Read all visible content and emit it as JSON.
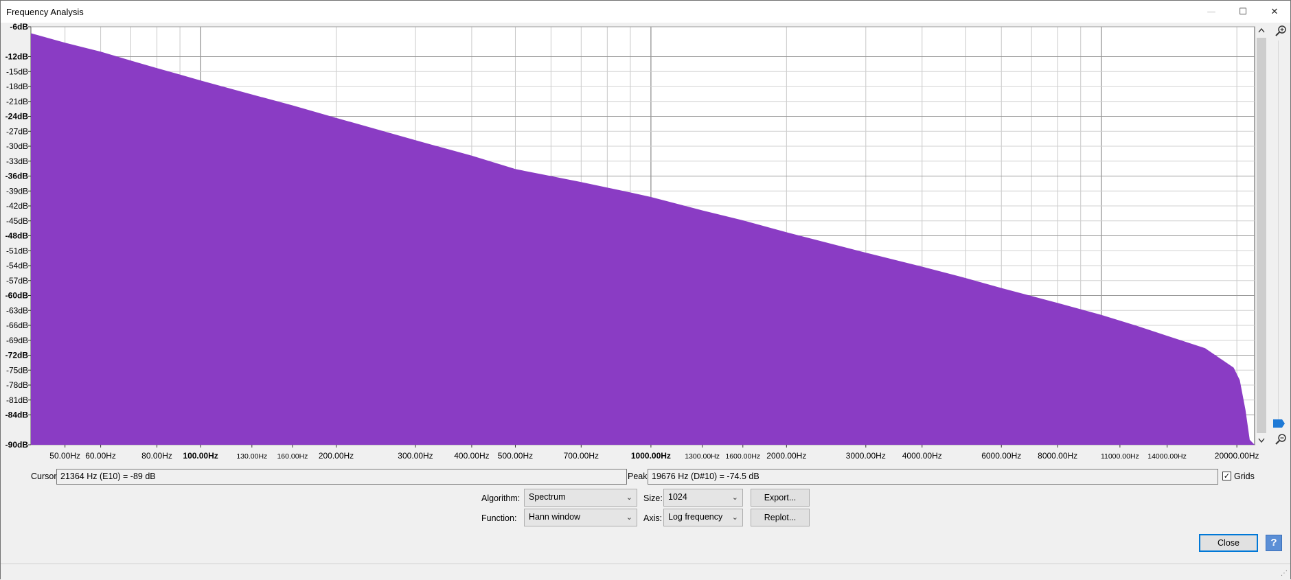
{
  "window": {
    "title": "Frequency Analysis",
    "controls": {
      "minimize": "—",
      "maximize": "☐",
      "close": "✕"
    }
  },
  "chart_data": {
    "type": "area",
    "x_scale": "log",
    "xlabel": "",
    "ylabel": "",
    "xlim": [
      42,
      21900
    ],
    "ylim": [
      -90,
      -6
    ],
    "grid": true,
    "fill_color": "#8a3cc4",
    "x_ticks": [
      {
        "value": 50,
        "label": "50.00Hz",
        "small": false,
        "bold": false
      },
      {
        "value": 60,
        "label": "60.00Hz",
        "small": false,
        "bold": false
      },
      {
        "value": 80,
        "label": "80.00Hz",
        "small": false,
        "bold": false
      },
      {
        "value": 100,
        "label": "100.00Hz",
        "small": false,
        "bold": true
      },
      {
        "value": 130,
        "label": "130.00Hz",
        "small": true,
        "bold": false
      },
      {
        "value": 160,
        "label": "160.00Hz",
        "small": true,
        "bold": false
      },
      {
        "value": 200,
        "label": "200.00Hz",
        "small": false,
        "bold": false
      },
      {
        "value": 300,
        "label": "300.00Hz",
        "small": false,
        "bold": false
      },
      {
        "value": 400,
        "label": "400.00Hz",
        "small": false,
        "bold": false
      },
      {
        "value": 500,
        "label": "500.00Hz",
        "small": false,
        "bold": false
      },
      {
        "value": 700,
        "label": "700.00Hz",
        "small": false,
        "bold": false
      },
      {
        "value": 1000,
        "label": "1000.00Hz",
        "small": false,
        "bold": true
      },
      {
        "value": 1300,
        "label": "1300.00Hz",
        "small": true,
        "bold": false
      },
      {
        "value": 1600,
        "label": "1600.00Hz",
        "small": true,
        "bold": false
      },
      {
        "value": 2000,
        "label": "2000.00Hz",
        "small": false,
        "bold": false
      },
      {
        "value": 3000,
        "label": "3000.00Hz",
        "small": false,
        "bold": false
      },
      {
        "value": 4000,
        "label": "4000.00Hz",
        "small": false,
        "bold": false
      },
      {
        "value": 6000,
        "label": "6000.00Hz",
        "small": false,
        "bold": false
      },
      {
        "value": 8000,
        "label": "8000.00Hz",
        "small": false,
        "bold": false
      },
      {
        "value": 11000,
        "label": "11000.00Hz",
        "small": true,
        "bold": false
      },
      {
        "value": 14000,
        "label": "14000.00Hz",
        "small": true,
        "bold": false
      },
      {
        "value": 20000,
        "label": "20000.00Hz",
        "small": false,
        "bold": false
      }
    ],
    "x_gridlines": [
      50,
      60,
      70,
      80,
      90,
      100,
      200,
      300,
      400,
      500,
      600,
      700,
      800,
      900,
      1000,
      2000,
      3000,
      4000,
      5000,
      6000,
      7000,
      8000,
      9000,
      10000,
      20000
    ],
    "y_ticks": [
      {
        "value": -6,
        "label": "-6dB",
        "bold": true
      },
      {
        "value": -12,
        "label": "-12dB",
        "bold": true
      },
      {
        "value": -15,
        "label": "-15dB",
        "bold": false
      },
      {
        "value": -18,
        "label": "-18dB",
        "bold": false
      },
      {
        "value": -21,
        "label": "-21dB",
        "bold": false
      },
      {
        "value": -24,
        "label": "-24dB",
        "bold": true
      },
      {
        "value": -27,
        "label": "-27dB",
        "bold": false
      },
      {
        "value": -30,
        "label": "-30dB",
        "bold": false
      },
      {
        "value": -33,
        "label": "-33dB",
        "bold": false
      },
      {
        "value": -36,
        "label": "-36dB",
        "bold": true
      },
      {
        "value": -39,
        "label": "-39dB",
        "bold": false
      },
      {
        "value": -42,
        "label": "-42dB",
        "bold": false
      },
      {
        "value": -45,
        "label": "-45dB",
        "bold": false
      },
      {
        "value": -48,
        "label": "-48dB",
        "bold": true
      },
      {
        "value": -51,
        "label": "-51dB",
        "bold": false
      },
      {
        "value": -54,
        "label": "-54dB",
        "bold": false
      },
      {
        "value": -57,
        "label": "-57dB",
        "bold": false
      },
      {
        "value": -60,
        "label": "-60dB",
        "bold": true
      },
      {
        "value": -63,
        "label": "-63dB",
        "bold": false
      },
      {
        "value": -66,
        "label": "-66dB",
        "bold": false
      },
      {
        "value": -69,
        "label": "-69dB",
        "bold": false
      },
      {
        "value": -72,
        "label": "-72dB",
        "bold": true
      },
      {
        "value": -75,
        "label": "-75dB",
        "bold": false
      },
      {
        "value": -78,
        "label": "-78dB",
        "bold": false
      },
      {
        "value": -81,
        "label": "-81dB",
        "bold": false
      },
      {
        "value": -84,
        "label": "-84dB",
        "bold": true
      },
      {
        "value": -90,
        "label": "-90dB",
        "bold": true
      }
    ],
    "series": [
      {
        "x": [
          42,
          50,
          60,
          70,
          80,
          90,
          100,
          130,
          160,
          200,
          300,
          400,
          500,
          700,
          900,
          1000,
          1300,
          1600,
          2000,
          3000,
          4000,
          5000,
          6000,
          7000,
          8000,
          10000,
          12000,
          14000,
          17000,
          19676,
          20300,
          20900,
          21364,
          21900
        ],
        "y": [
          -7.3,
          -9.2,
          -11,
          -12.8,
          -14.3,
          -15.6,
          -16.8,
          -19.6,
          -21.8,
          -24.3,
          -28.8,
          -31.9,
          -34.6,
          -37.2,
          -39.3,
          -40.2,
          -42.9,
          -44.9,
          -47.3,
          -51.4,
          -54.2,
          -56.5,
          -58.5,
          -60.1,
          -61.5,
          -63.9,
          -66.1,
          -68.1,
          -70.6,
          -74.5,
          -77,
          -83,
          -89,
          -90
        ]
      }
    ]
  },
  "cursor": {
    "label": "Cursor:",
    "value": "21364 Hz (E10) = -89 dB"
  },
  "peak": {
    "label": "Peak:",
    "value": "19676 Hz (D#10) = -74.5 dB"
  },
  "grids": {
    "label": "Grids",
    "checked": true,
    "check_glyph": "✓"
  },
  "algorithm": {
    "label": "Algorithm:",
    "value": "Spectrum"
  },
  "size": {
    "label": "Size:",
    "value": "1024"
  },
  "function": {
    "label": "Function:",
    "value": "Hann window"
  },
  "axis": {
    "label": "Axis:",
    "value": "Log frequency"
  },
  "buttons": {
    "export": "Export...",
    "replot": "Replot...",
    "close": "Close",
    "help": "?"
  },
  "icons": {
    "zoom_in": "zoom-in-icon",
    "zoom_out": "zoom-out-icon",
    "slider": "zoom-slider-thumb"
  }
}
